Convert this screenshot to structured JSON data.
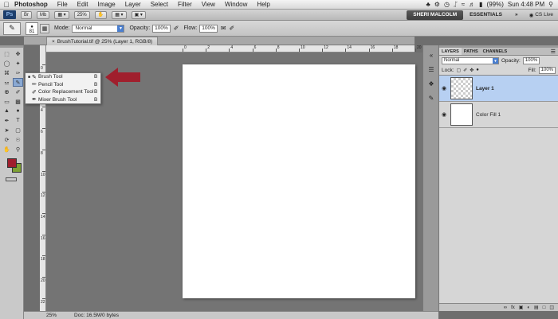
{
  "menubar": {
    "app_name": "Photoshop",
    "items": [
      "File",
      "Edit",
      "Image",
      "Layer",
      "Select",
      "Filter",
      "View",
      "Window",
      "Help"
    ],
    "battery": "(99%)",
    "clock": "Sun 4:48 PM"
  },
  "appbar": {
    "logo": "Ps",
    "zoom": "25%",
    "user": "SHERI MALCOLM",
    "workspace": "ESSENTIALS",
    "more": "»",
    "cs_live": "CS Live"
  },
  "options": {
    "brush_size": "81",
    "mode_label": "Mode:",
    "mode_value": "Normal",
    "opacity_label": "Opacity:",
    "opacity_value": "100%",
    "flow_label": "Flow:",
    "flow_value": "100%"
  },
  "document": {
    "tab_title": "BrushTutorial.tif @ 25% (Layer 1, RGB/8)",
    "ruler_top": [
      "0",
      "2",
      "4",
      "6",
      "8",
      "10",
      "12",
      "14",
      "16",
      "18",
      "20"
    ],
    "ruler_left": [
      "0",
      "2",
      "4",
      "6",
      "8",
      "10",
      "12",
      "14",
      "16",
      "18",
      "20",
      "22"
    ]
  },
  "flyout": {
    "items": [
      {
        "label": "Brush Tool",
        "key": "B",
        "icon": "brush-icon",
        "active": true
      },
      {
        "label": "Pencil Tool",
        "key": "B",
        "icon": "pencil-icon",
        "active": false
      },
      {
        "label": "Color Replacement Tool",
        "key": "B",
        "icon": "color-replacement-icon",
        "active": false
      },
      {
        "label": "Mixer Brush Tool",
        "key": "B",
        "icon": "mixer-brush-icon",
        "active": false
      }
    ]
  },
  "colors": {
    "foreground": "#a01f2d",
    "background": "#7ea234",
    "arrow": "#a01f2d",
    "selection": "#b7d0f2"
  },
  "layers_panel": {
    "tabs": [
      "LAYERS",
      "PATHS",
      "CHANNELS"
    ],
    "blend_mode": "Normal",
    "opacity_label": "Opacity:",
    "opacity_value": "100%",
    "lock_label": "Lock:",
    "fill_label": "Fill:",
    "fill_value": "100%",
    "layers": [
      {
        "name": "Layer 1",
        "selected": true,
        "transparent": true
      },
      {
        "name": "Color Fill 1",
        "selected": false,
        "transparent": false
      }
    ]
  },
  "status": {
    "zoom": "25%",
    "doc": "Doc: 16.5M/0 bytes"
  }
}
